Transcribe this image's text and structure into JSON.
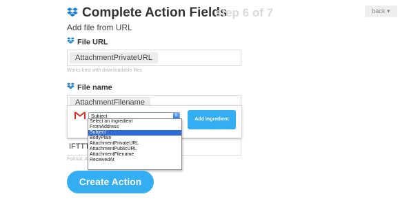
{
  "header": {
    "title": "Complete Action Fields",
    "step": "step 6 of 7",
    "back_label": "back"
  },
  "subtitle": "Add file from URL",
  "fields": {
    "file_url": {
      "label": "File URL",
      "ingredient": "AttachmentPrivateURL",
      "hint": "Works best with downloadable files"
    },
    "file_name": {
      "label": "File name",
      "ingredient": "AttachmentFilename"
    },
    "folder": {
      "value_partial": "IFTTT/",
      "hint_partial": "Format: A"
    }
  },
  "ingredient_popup": {
    "selected": "Subject",
    "add_label": "Add Ingredient",
    "options": [
      "Select an Ingredient",
      "FromAddress",
      "Subject",
      "BodyPlain",
      "AttachmentPrivateURL",
      "AttachmentPublicURL",
      "AttachmentFilename",
      "ReceivedAt"
    ]
  },
  "create_label": "Create Action",
  "colors": {
    "accent": "#33aef2",
    "dropbox": "#1a7fd4"
  }
}
